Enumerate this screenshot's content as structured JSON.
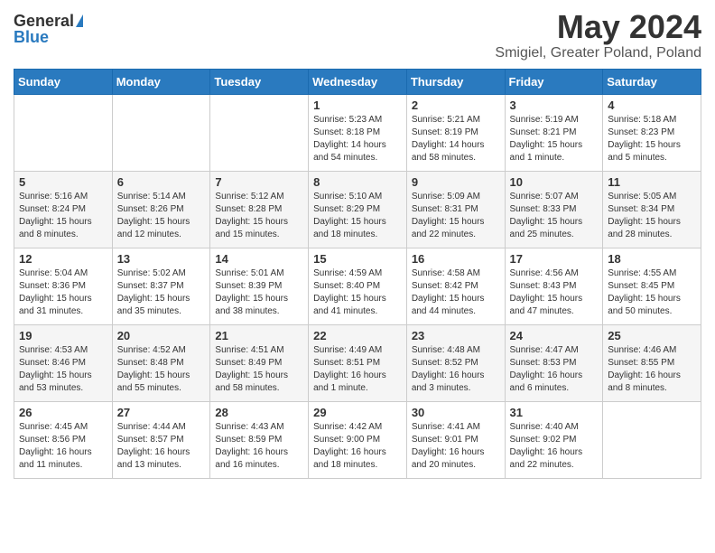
{
  "header": {
    "logo_general": "General",
    "logo_blue": "Blue",
    "month_title": "May 2024",
    "location": "Smigiel, Greater Poland, Poland"
  },
  "days_of_week": [
    "Sunday",
    "Monday",
    "Tuesday",
    "Wednesday",
    "Thursday",
    "Friday",
    "Saturday"
  ],
  "weeks": [
    [
      {
        "day": "",
        "info": ""
      },
      {
        "day": "",
        "info": ""
      },
      {
        "day": "",
        "info": ""
      },
      {
        "day": "1",
        "info": "Sunrise: 5:23 AM\nSunset: 8:18 PM\nDaylight: 14 hours\nand 54 minutes."
      },
      {
        "day": "2",
        "info": "Sunrise: 5:21 AM\nSunset: 8:19 PM\nDaylight: 14 hours\nand 58 minutes."
      },
      {
        "day": "3",
        "info": "Sunrise: 5:19 AM\nSunset: 8:21 PM\nDaylight: 15 hours\nand 1 minute."
      },
      {
        "day": "4",
        "info": "Sunrise: 5:18 AM\nSunset: 8:23 PM\nDaylight: 15 hours\nand 5 minutes."
      }
    ],
    [
      {
        "day": "5",
        "info": "Sunrise: 5:16 AM\nSunset: 8:24 PM\nDaylight: 15 hours\nand 8 minutes."
      },
      {
        "day": "6",
        "info": "Sunrise: 5:14 AM\nSunset: 8:26 PM\nDaylight: 15 hours\nand 12 minutes."
      },
      {
        "day": "7",
        "info": "Sunrise: 5:12 AM\nSunset: 8:28 PM\nDaylight: 15 hours\nand 15 minutes."
      },
      {
        "day": "8",
        "info": "Sunrise: 5:10 AM\nSunset: 8:29 PM\nDaylight: 15 hours\nand 18 minutes."
      },
      {
        "day": "9",
        "info": "Sunrise: 5:09 AM\nSunset: 8:31 PM\nDaylight: 15 hours\nand 22 minutes."
      },
      {
        "day": "10",
        "info": "Sunrise: 5:07 AM\nSunset: 8:33 PM\nDaylight: 15 hours\nand 25 minutes."
      },
      {
        "day": "11",
        "info": "Sunrise: 5:05 AM\nSunset: 8:34 PM\nDaylight: 15 hours\nand 28 minutes."
      }
    ],
    [
      {
        "day": "12",
        "info": "Sunrise: 5:04 AM\nSunset: 8:36 PM\nDaylight: 15 hours\nand 31 minutes."
      },
      {
        "day": "13",
        "info": "Sunrise: 5:02 AM\nSunset: 8:37 PM\nDaylight: 15 hours\nand 35 minutes."
      },
      {
        "day": "14",
        "info": "Sunrise: 5:01 AM\nSunset: 8:39 PM\nDaylight: 15 hours\nand 38 minutes."
      },
      {
        "day": "15",
        "info": "Sunrise: 4:59 AM\nSunset: 8:40 PM\nDaylight: 15 hours\nand 41 minutes."
      },
      {
        "day": "16",
        "info": "Sunrise: 4:58 AM\nSunset: 8:42 PM\nDaylight: 15 hours\nand 44 minutes."
      },
      {
        "day": "17",
        "info": "Sunrise: 4:56 AM\nSunset: 8:43 PM\nDaylight: 15 hours\nand 47 minutes."
      },
      {
        "day": "18",
        "info": "Sunrise: 4:55 AM\nSunset: 8:45 PM\nDaylight: 15 hours\nand 50 minutes."
      }
    ],
    [
      {
        "day": "19",
        "info": "Sunrise: 4:53 AM\nSunset: 8:46 PM\nDaylight: 15 hours\nand 53 minutes."
      },
      {
        "day": "20",
        "info": "Sunrise: 4:52 AM\nSunset: 8:48 PM\nDaylight: 15 hours\nand 55 minutes."
      },
      {
        "day": "21",
        "info": "Sunrise: 4:51 AM\nSunset: 8:49 PM\nDaylight: 15 hours\nand 58 minutes."
      },
      {
        "day": "22",
        "info": "Sunrise: 4:49 AM\nSunset: 8:51 PM\nDaylight: 16 hours\nand 1 minute."
      },
      {
        "day": "23",
        "info": "Sunrise: 4:48 AM\nSunset: 8:52 PM\nDaylight: 16 hours\nand 3 minutes."
      },
      {
        "day": "24",
        "info": "Sunrise: 4:47 AM\nSunset: 8:53 PM\nDaylight: 16 hours\nand 6 minutes."
      },
      {
        "day": "25",
        "info": "Sunrise: 4:46 AM\nSunset: 8:55 PM\nDaylight: 16 hours\nand 8 minutes."
      }
    ],
    [
      {
        "day": "26",
        "info": "Sunrise: 4:45 AM\nSunset: 8:56 PM\nDaylight: 16 hours\nand 11 minutes."
      },
      {
        "day": "27",
        "info": "Sunrise: 4:44 AM\nSunset: 8:57 PM\nDaylight: 16 hours\nand 13 minutes."
      },
      {
        "day": "28",
        "info": "Sunrise: 4:43 AM\nSunset: 8:59 PM\nDaylight: 16 hours\nand 16 minutes."
      },
      {
        "day": "29",
        "info": "Sunrise: 4:42 AM\nSunset: 9:00 PM\nDaylight: 16 hours\nand 18 minutes."
      },
      {
        "day": "30",
        "info": "Sunrise: 4:41 AM\nSunset: 9:01 PM\nDaylight: 16 hours\nand 20 minutes."
      },
      {
        "day": "31",
        "info": "Sunrise: 4:40 AM\nSunset: 9:02 PM\nDaylight: 16 hours\nand 22 minutes."
      },
      {
        "day": "",
        "info": ""
      }
    ]
  ]
}
